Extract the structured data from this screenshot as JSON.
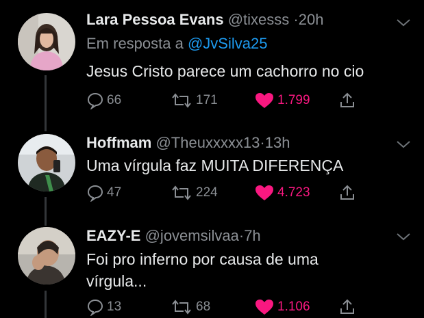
{
  "tweets": [
    {
      "name": "Lara Pessoa Evans",
      "handle": "@tixesss",
      "separator": "·",
      "time": "20h",
      "reply_prefix": "Em resposta a",
      "reply_mention": "@JvSilva25",
      "text": "Jesus Cristo parece um cachorro no cio",
      "replies": "66",
      "retweets": "171",
      "likes": "1.799",
      "liked": true
    },
    {
      "name": "Hoffmam",
      "handle": "@Theuxxxxx13",
      "separator": "·",
      "time": "13h",
      "text": "Uma vírgula faz MUITA DIFERENÇA",
      "replies": "47",
      "retweets": "224",
      "likes": "4.723",
      "liked": true
    },
    {
      "name": "EAZY-E",
      "handle": "@jovemsilvaa",
      "separator": "·",
      "time": "7h",
      "text_line1": "Foi pro inferno por causa de uma",
      "text_line2": "vírgula...",
      "replies": "13",
      "retweets": "68",
      "likes": "1.106",
      "liked": true
    }
  ],
  "icons": {
    "reply": "reply-icon",
    "retweet": "retweet-icon",
    "like": "heart-icon",
    "share": "share-icon",
    "menu": "chevron-down-icon"
  },
  "colors": {
    "background": "#000000",
    "text": "#e7e9ea",
    "muted": "#8b8f94",
    "link": "#1d9bf0",
    "like": "#f91880"
  }
}
